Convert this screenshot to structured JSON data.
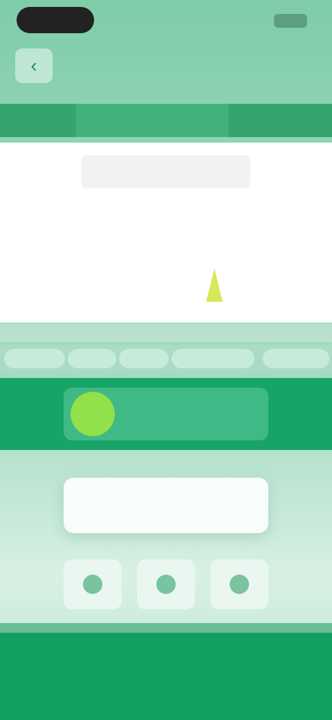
{
  "status": {
    "time": ""
  },
  "header": {
    "title": "",
    "back_icon": "chevron-left-icon"
  },
  "tabs": [
    {
      "label": ""
    },
    {
      "label": ""
    },
    {
      "label": ""
    },
    {
      "label": ""
    }
  ],
  "card": {
    "title": ""
  },
  "chips": [
    {
      "label": ""
    },
    {
      "label": ""
    },
    {
      "label": ""
    },
    {
      "label": ""
    },
    {
      "label": ""
    }
  ],
  "banner": {
    "text": ""
  },
  "action": {
    "label": ""
  },
  "icons": [
    {
      "name": "play-icon"
    },
    {
      "name": "pause-icon"
    },
    {
      "name": "next-icon"
    }
  ],
  "colors": {
    "primary_green": "#17a466",
    "accent_lime": "#92e04a",
    "card_white": "#ffffff"
  }
}
